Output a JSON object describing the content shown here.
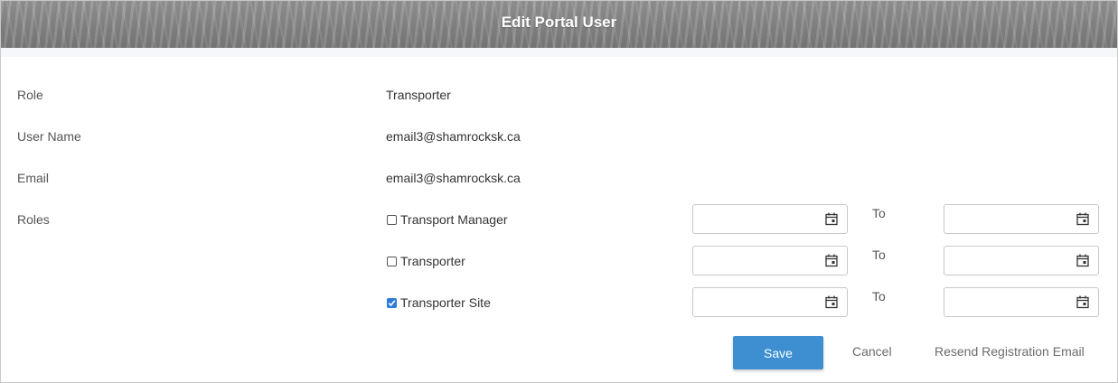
{
  "header": {
    "title": "Edit Portal User"
  },
  "fields": {
    "role": {
      "label": "Role",
      "value": "Transporter"
    },
    "username": {
      "label": "User Name",
      "value": "email3@shamrocksk.ca"
    },
    "email": {
      "label": "Email",
      "value": "email3@shamrocksk.ca"
    },
    "roles_label": "Roles"
  },
  "roles": [
    {
      "name": "Transport Manager",
      "checked": false,
      "from": "",
      "to_label": "To",
      "to": ""
    },
    {
      "name": "Transporter",
      "checked": false,
      "from": "",
      "to_label": "To",
      "to": ""
    },
    {
      "name": "Transporter Site",
      "checked": true,
      "from": "",
      "to_label": "To",
      "to": ""
    }
  ],
  "actions": {
    "save": "Save",
    "cancel": "Cancel",
    "resend": "Resend Registration Email"
  },
  "colors": {
    "primary": "#3d8fd1",
    "checkbox_checked": "#2f7bd8"
  },
  "icons": {
    "date": "calendar-icon",
    "checkbox": "checkmark-icon"
  }
}
